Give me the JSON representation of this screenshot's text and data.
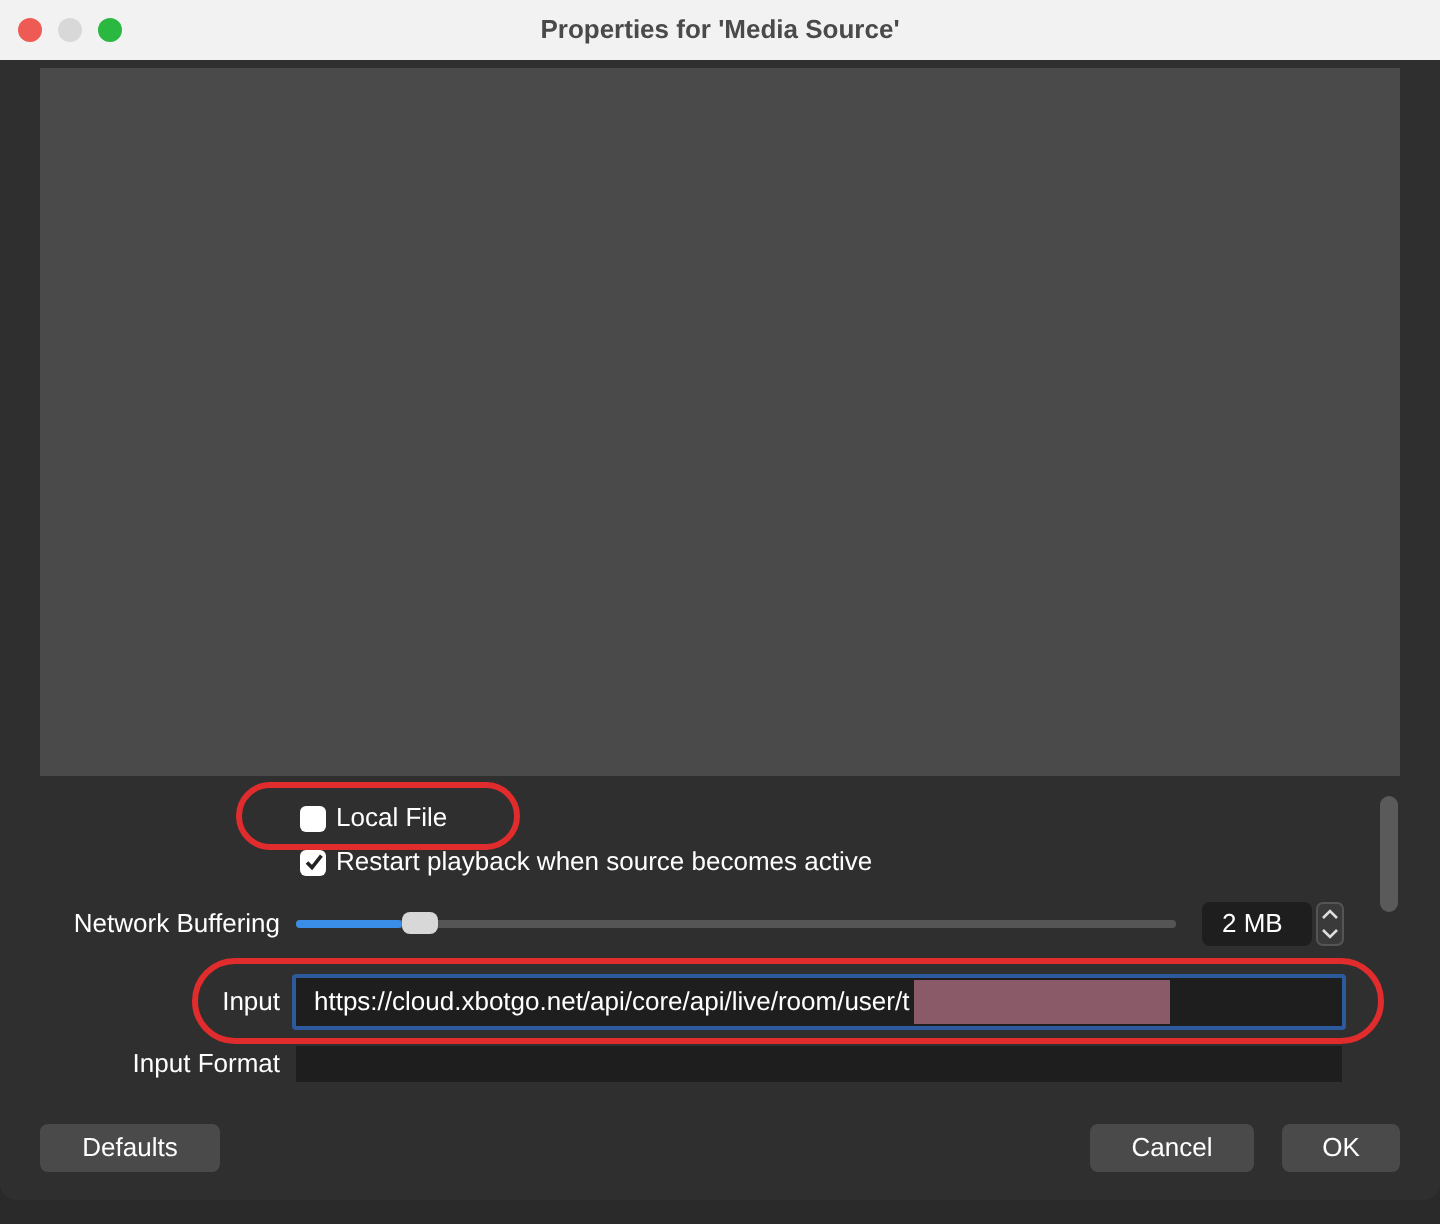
{
  "window": {
    "title": "Properties for 'Media Source'"
  },
  "checkboxes": [
    {
      "label": "Local File",
      "checked": false,
      "annotated": true
    },
    {
      "label": "Restart playback when source becomes active",
      "checked": true,
      "annotated": false
    }
  ],
  "network_buffering": {
    "label": "Network Buffering",
    "level": 0.12,
    "value": "2 MB"
  },
  "input": {
    "label": "Input",
    "value": "https://cloud.xbotgo.net/api/core/api/live/room/user/t",
    "redacted": true,
    "annotated": true
  },
  "input_format": {
    "label": "Input Format"
  },
  "buttons": {
    "defaults": "Defaults",
    "cancel": "Cancel",
    "ok": "OK"
  }
}
